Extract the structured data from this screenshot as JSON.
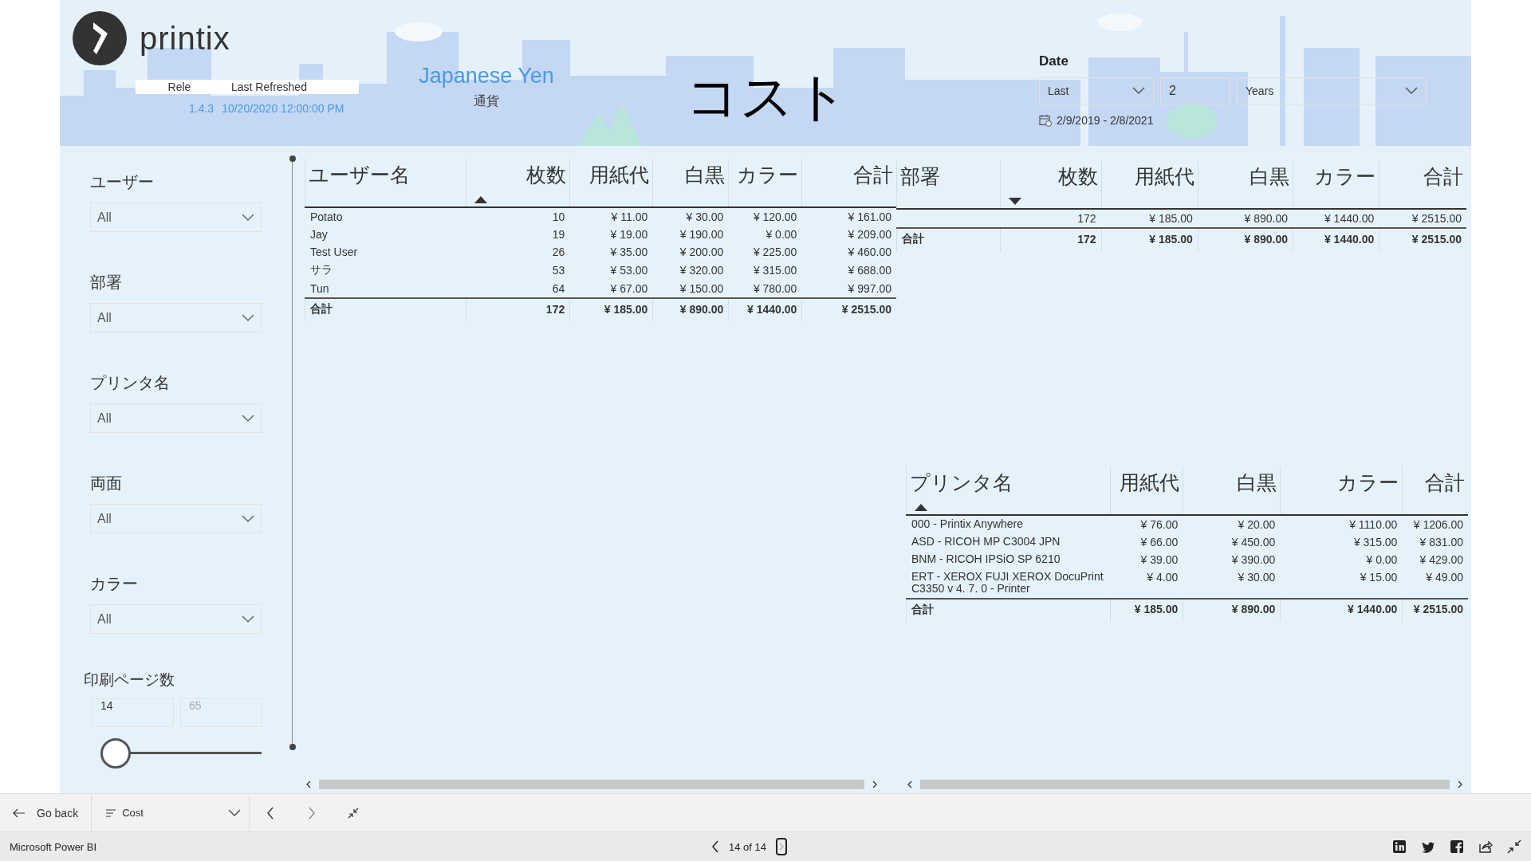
{
  "header": {
    "logo_text": "printix",
    "release_label": "Rele",
    "refreshed_label": "Last Refreshed",
    "version": "1.4.3",
    "refreshed": "10/20/2020 12:00:00 PM",
    "currency": "Japanese Yen",
    "currency_label": "通貨",
    "title": "コスト"
  },
  "date_filter": {
    "label": "Date",
    "mode": "Last",
    "count": "2",
    "unit": "Years",
    "range": "2/9/2019 - 2/8/2021"
  },
  "slicers": [
    {
      "label": "ユーザー",
      "value": "All"
    },
    {
      "label": "部署",
      "value": "All"
    },
    {
      "label": "プリンタ名",
      "value": "All"
    },
    {
      "label": "両面",
      "value": "All"
    },
    {
      "label": "カラー",
      "value": "All"
    }
  ],
  "page_range": {
    "label": "印刷ページ数",
    "min": "14",
    "max": "65",
    "level": 0
  },
  "tables": [
    {
      "columns": [
        {
          "label": "ユーザー名",
          "sort_up": false,
          "sort_down": false
        },
        {
          "label": "枚数",
          "sort_up": true,
          "sort_down": false
        },
        {
          "label": "用紙代",
          "sort_up": false,
          "sort_down": false
        },
        {
          "label": "白黒",
          "sort_up": false,
          "sort_down": false
        },
        {
          "label": "カラー",
          "sort_up": false,
          "sort_down": false
        },
        {
          "label": "合計",
          "sort_up": false,
          "sort_down": false
        }
      ],
      "rows": [
        [
          "Potato",
          "10",
          "¥ 11.00",
          "¥ 30.00",
          "¥ 120.00",
          "¥ 161.00"
        ],
        [
          "Jay",
          "19",
          "¥ 19.00",
          "¥ 190.00",
          "¥ 0.00",
          "¥ 209.00"
        ],
        [
          "Test User",
          "26",
          "¥ 35.00",
          "¥ 200.00",
          "¥ 225.00",
          "¥ 460.00"
        ],
        [
          "サラ",
          "53",
          "¥ 53.00",
          "¥ 320.00",
          "¥ 315.00",
          "¥ 688.00"
        ],
        [
          "Tun",
          "64",
          "¥ 67.00",
          "¥ 150.00",
          "¥ 780.00",
          "¥ 997.00"
        ]
      ],
      "total": [
        "合計",
        "172",
        "¥ 185.00",
        "¥ 890.00",
        "¥ 1440.00",
        "¥ 2515.00"
      ]
    },
    {
      "columns": [
        {
          "label": "部署",
          "sort_up": false,
          "sort_down": false
        },
        {
          "label": "枚数",
          "sort_up": false,
          "sort_down": true
        },
        {
          "label": "用紙代",
          "sort_up": false,
          "sort_down": false
        },
        {
          "label": "白黒",
          "sort_up": false,
          "sort_down": false
        },
        {
          "label": "カラー",
          "sort_up": false,
          "sort_down": false
        },
        {
          "label": "合計",
          "sort_up": false,
          "sort_down": false
        }
      ],
      "rows": [
        [
          null,
          "172",
          "¥ 185.00",
          "¥ 890.00",
          "¥ 1440.00",
          "¥ 2515.00"
        ]
      ],
      "total": [
        "合計",
        "172",
        "¥ 185.00",
        "¥ 890.00",
        "¥ 1440.00",
        "¥ 2515.00"
      ]
    },
    {
      "columns": [
        {
          "label": "プリンタ名",
          "sort_up": true,
          "sort_down": false
        },
        {
          "label": "用紙代",
          "sort_up": false,
          "sort_down": false
        },
        {
          "label": "白黒",
          "sort_up": false,
          "sort_down": false
        },
        {
          "label": "カラー",
          "sort_up": false,
          "sort_down": false
        },
        {
          "label": "合計",
          "sort_up": false,
          "sort_down": false
        }
      ],
      "rows": [
        [
          "000 - Printix Anywhere",
          "¥ 76.00",
          "¥ 20.00",
          "¥ 1110.00",
          "¥ 1206.00"
        ],
        [
          "ASD - RICOH MP C3004 JPN",
          "¥ 66.00",
          "¥ 450.00",
          "¥ 315.00",
          "¥ 831.00"
        ],
        [
          "BNM - RICOH IPSiO SP 6210",
          "¥ 39.00",
          "¥ 390.00",
          "¥ 0.00",
          "¥ 429.00"
        ],
        [
          "ERT - XEROX FUJI XEROX DocuPrint C3350 v 4. 7. 0 - Printer",
          "¥ 4.00",
          "¥ 30.00",
          "¥ 15.00",
          "¥ 49.00"
        ]
      ],
      "total": [
        "合計",
        "¥ 185.00",
        "¥ 890.00",
        "¥ 1440.00",
        "¥ 2515.00"
      ]
    }
  ],
  "nav": {
    "back": "Go back",
    "page": "Cost"
  },
  "status_bar": {
    "app": "Microsoft Power BI",
    "pager": "14 of 14"
  }
}
